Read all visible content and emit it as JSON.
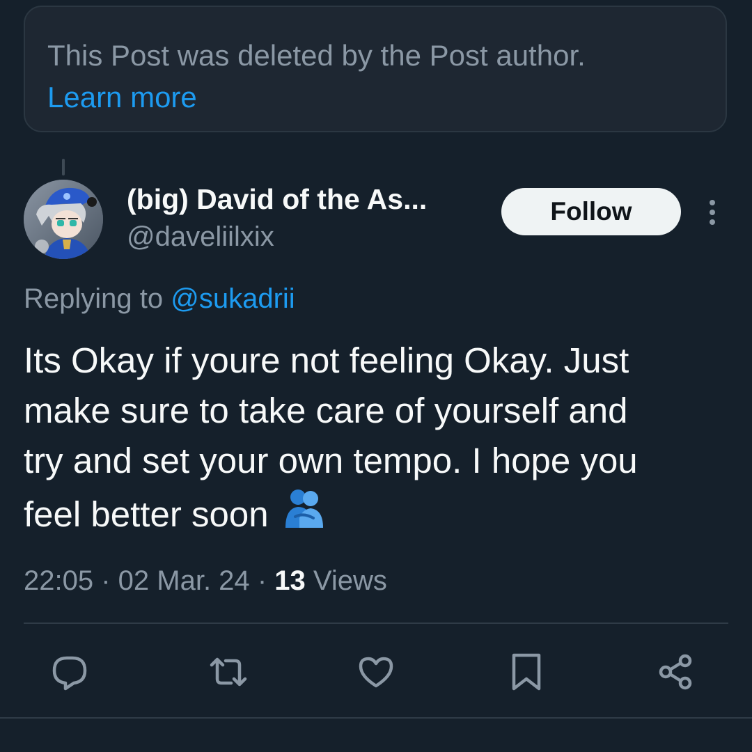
{
  "deleted_notice": {
    "text": "This Post was deleted by the Post author.",
    "link_label": "Learn more"
  },
  "post": {
    "author": {
      "display_name": "(big) David of the As...",
      "handle": "@daveliilxix",
      "avatar_icon": "anime-character-avatar"
    },
    "follow_label": "Follow",
    "replying_prefix": "Replying to",
    "replying_to": "@sukadrii",
    "text_lines": [
      "Its Okay if youre not feeling Okay. Just",
      "make sure to take care of yourself and",
      "try and set your own tempo. I hope you",
      "feel better soon"
    ],
    "emoji": "people-hugging-emoji",
    "time": "22:05",
    "date": "02 Mar. 24",
    "views_count": "13",
    "views_label": "Views"
  },
  "actions": [
    "reply-icon",
    "repost-icon",
    "like-icon",
    "bookmark-icon",
    "share-icon"
  ],
  "colors": {
    "background": "#15202b",
    "accent": "#1d9bf0",
    "muted": "#8b98a5",
    "text": "#f7f9f9"
  }
}
